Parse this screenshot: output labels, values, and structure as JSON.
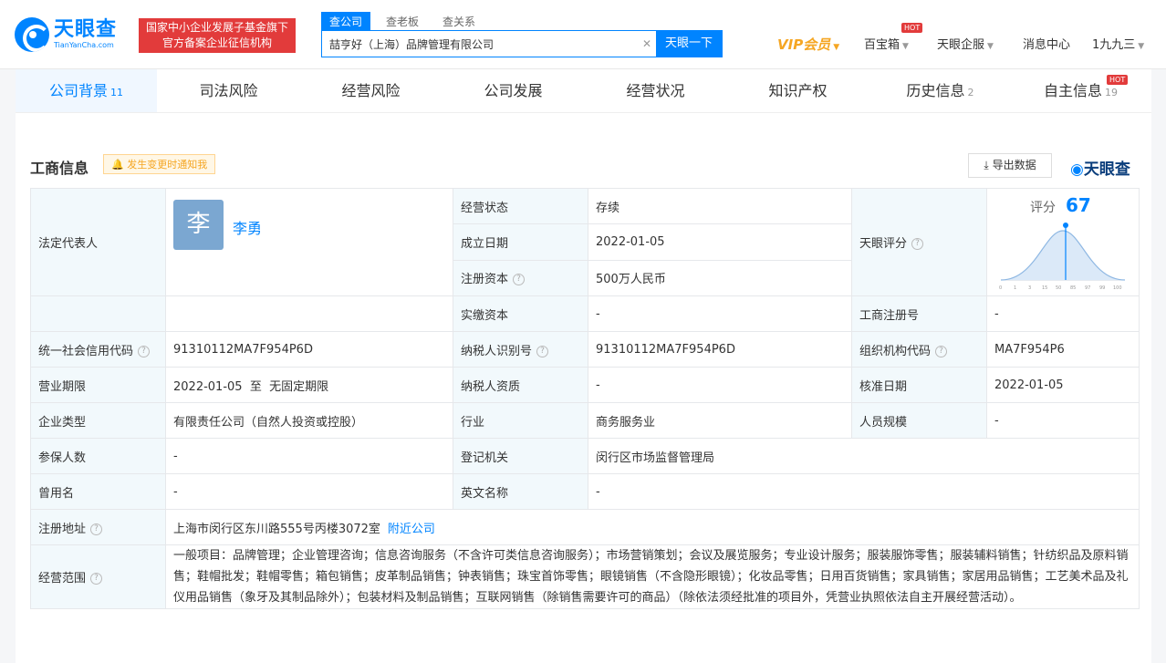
{
  "header": {
    "logo_cn": "天眼查",
    "logo_en": "TianYanCha.com",
    "badge_line1": "国家中小企业发展子基金旗下",
    "badge_line2": "官方备案企业征信机构",
    "search_tabs": [
      "查公司",
      "查老板",
      "查关系"
    ],
    "search_value": "喆亨好（上海）品牌管理有限公司",
    "search_button": "天眼一下",
    "nav": {
      "vip": "VIP会员",
      "baibaoxiang": "百宝箱",
      "qiye": "天眼企服",
      "messages": "消息中心",
      "user": "1九九三"
    },
    "hot": "HOT"
  },
  "tabs": [
    {
      "label": "公司背景",
      "count": "11"
    },
    {
      "label": "司法风险",
      "count": ""
    },
    {
      "label": "经营风险",
      "count": ""
    },
    {
      "label": "公司发展",
      "count": ""
    },
    {
      "label": "经营状况",
      "count": ""
    },
    {
      "label": "知识产权",
      "count": ""
    },
    {
      "label": "历史信息",
      "count": "2"
    },
    {
      "label": "自主信息",
      "count": "19"
    }
  ],
  "section": {
    "title": "工商信息",
    "notify": "发生变更时通知我",
    "export": "导出数据",
    "brand": "天眼查"
  },
  "info": {
    "legal_rep_label": "法定代表人",
    "avatar_char": "李",
    "legal_rep_name": "李勇",
    "status_label": "经营状态",
    "status_value": "存续",
    "founded_label": "成立日期",
    "founded_value": "2022-01-05",
    "capital_label": "注册资本",
    "capital_value": "500万人民币",
    "paid_label": "实缴资本",
    "paid_value": "-",
    "score_label": "天眼评分",
    "score_title": "评分",
    "score_value": "67",
    "score_ticks": [
      "0",
      "1",
      "3",
      "15",
      "50",
      "85",
      "97",
      "99",
      "100"
    ],
    "regno_label": "工商注册号",
    "regno_value": "-",
    "credit_label": "统一社会信用代码",
    "credit_value": "91310112MA7F954P6D",
    "taxid_label": "纳税人识别号",
    "taxid_value": "91310112MA7F954P6D",
    "orgcode_label": "组织机构代码",
    "orgcode_value": "MA7F954P6",
    "term_label": "营业期限",
    "term_value": "2022-01-05  至  无固定期限",
    "taxqual_label": "纳税人资质",
    "taxqual_value": "-",
    "approve_label": "核准日期",
    "approve_value": "2022-01-05",
    "type_label": "企业类型",
    "type_value": "有限责任公司（自然人投资或控股）",
    "industry_label": "行业",
    "industry_value": "商务服务业",
    "staff_label": "人员规模",
    "staff_value": "-",
    "insured_label": "参保人数",
    "insured_value": "-",
    "authority_label": "登记机关",
    "authority_value": "闵行区市场监督管理局",
    "former_label": "曾用名",
    "former_value": "-",
    "english_label": "英文名称",
    "english_value": "-",
    "address_label": "注册地址",
    "address_value": "上海市闵行区东川路555号丙楼3072室",
    "address_link": "附近公司",
    "scope_label": "经营范围",
    "scope_value": "一般项目：品牌管理；企业管理咨询；信息咨询服务（不含许可类信息咨询服务）；市场营销策划；会议及展览服务；专业设计服务；服装服饰零售；服装辅料销售；针纺织品及原料销售；鞋帽批发；鞋帽零售；箱包销售；皮革制品销售；钟表销售；珠宝首饰零售；眼镜销售（不含隐形眼镜）；化妆品零售；日用百货销售；家具销售；家居用品销售；工艺美术品及礼仪用品销售（象牙及其制品除外）；包装材料及制品销售；互联网销售（除销售需要许可的商品）（除依法须经批准的项目外，凭营业执照依法自主开展经营活动）。"
  },
  "colors": {
    "accent": "#0084ff",
    "badge_red": "#e23b3b",
    "vip": "#f5a623",
    "label_bg": "#f2f9fc"
  }
}
